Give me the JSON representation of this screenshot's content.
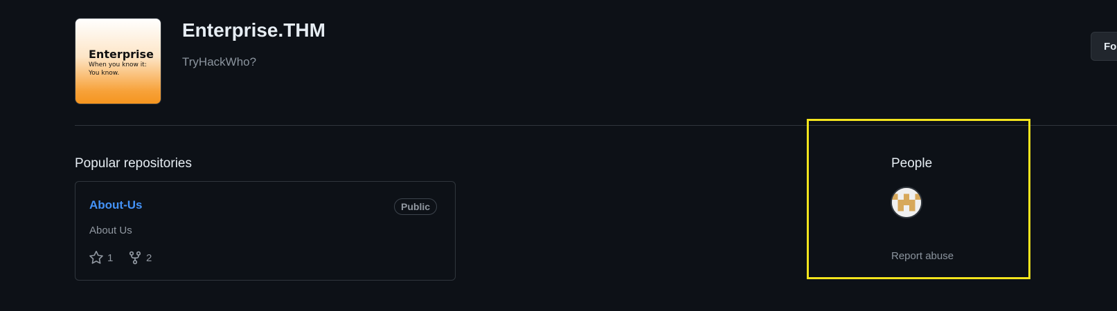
{
  "org": {
    "logo": {
      "title": "Enterprise",
      "tagline_1": "When you know it:",
      "tagline_2": "You know."
    },
    "name": "Enterprise.THM",
    "description": "TryHackWho?",
    "follow_label": "Fo"
  },
  "popular": {
    "title": "Popular repositories",
    "repos": [
      {
        "name": "About-Us",
        "visibility": "Public",
        "description": "About Us",
        "stars": "1",
        "forks": "2"
      }
    ]
  },
  "people": {
    "title": "People",
    "report_label": "Report abuse"
  },
  "colors": {
    "background": "#0d1117",
    "link": "#4493f8",
    "highlight": "#f4e51d"
  },
  "icons": [
    "star-icon",
    "fork-icon"
  ]
}
